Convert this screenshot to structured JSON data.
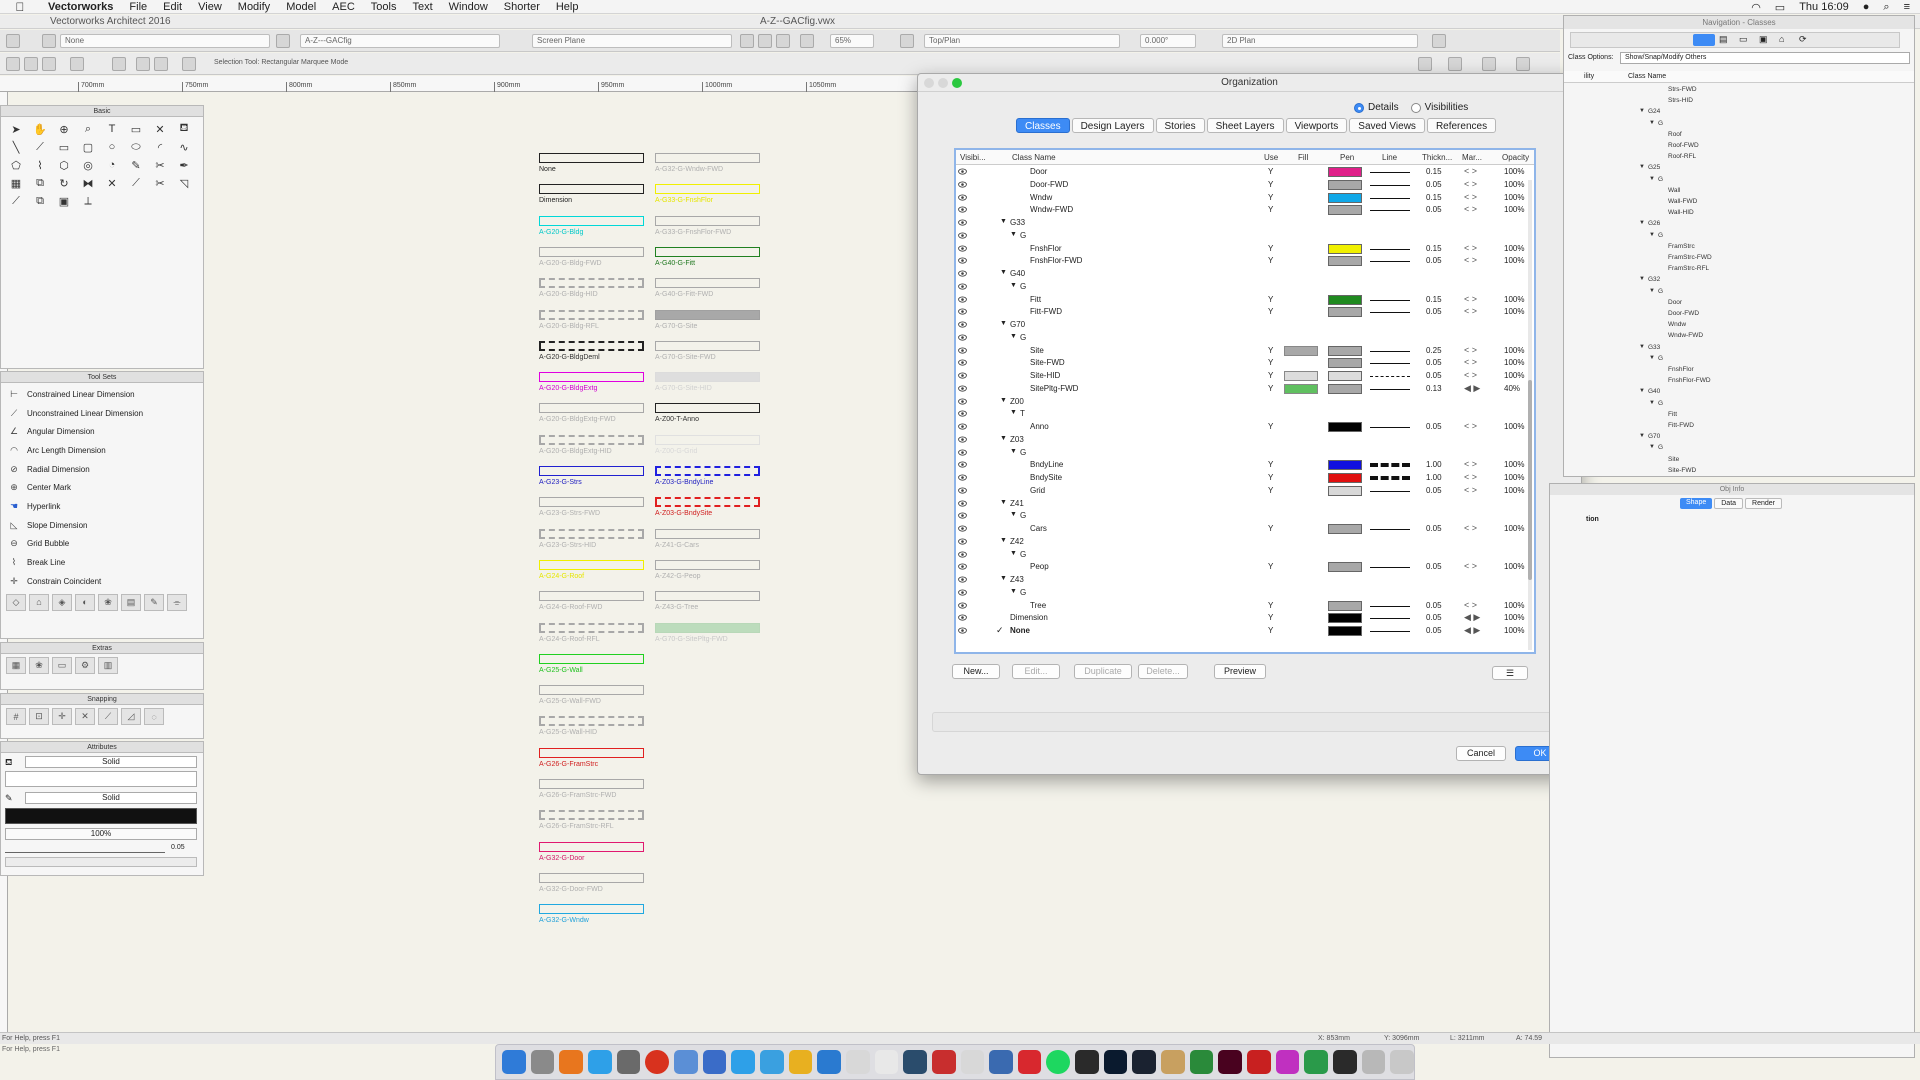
{
  "menubar": {
    "apple": "",
    "app_name": "Vectorworks",
    "items": [
      "File",
      "Edit",
      "View",
      "Modify",
      "Model",
      "AEC",
      "Tools",
      "Text",
      "Window",
      "Shorter",
      "Help"
    ],
    "clock": "Thu 16:09"
  },
  "window": {
    "app_title": "Vectorworks Architect 2016",
    "doc_title": "A-Z--GACfig.vwx"
  },
  "viewbar": {
    "class_field": "None",
    "layer_field": "A-Z---GACfig",
    "plane_field": "Screen Plane",
    "zoom_field": "65%",
    "view_field": "Top/Plan",
    "angle_field": "0.000°",
    "render_field": "2D Plan"
  },
  "modebar": {
    "hint": "Selection Tool: Rectangular Marquee Mode"
  },
  "ruler": {
    "ticks": [
      "700mm",
      "750mm",
      "800mm",
      "850mm",
      "900mm",
      "950mm",
      "1000mm",
      "1050mm"
    ]
  },
  "palettes": {
    "basic_title": "Basic",
    "toolsets_title": "Tool Sets",
    "extras_title": "Extras",
    "snapping_title": "Snapping",
    "attributes_title": "Attributes",
    "toolsets": [
      "Constrained Linear Dimension",
      "Unconstrained Linear Dimension",
      "Angular Dimension",
      "Arc Length Dimension",
      "Radial Dimension",
      "Center Mark",
      "Hyperlink",
      "Slope Dimension",
      "Grid Bubble",
      "Break Line",
      "Constrain Coincident"
    ],
    "attributes": {
      "fill_style": "Solid",
      "pen_style": "Solid",
      "opacity": "100%",
      "thickness": "0.05"
    }
  },
  "canvas": {
    "col1": [
      {
        "label": "None",
        "color": "#222222",
        "dashed": false,
        "labelColor": "#222222"
      },
      {
        "label": "Dimension",
        "color": "#222222",
        "dashed": false,
        "labelColor": "#222222"
      },
      {
        "label": "A-G20-G-Bldg",
        "color": "#00d8d8",
        "dashed": false,
        "labelColor": "#00c8c8"
      },
      {
        "label": "A-G20-G-Bldg-FWD",
        "color": "#a8a8a8",
        "dashed": false,
        "labelColor": "#b0b0b0"
      },
      {
        "label": "A-G20-G-Bldg-HID",
        "color": "#a8a8a8",
        "dashed": true,
        "labelColor": "#b0b0b0"
      },
      {
        "label": "A-G20-G-Bldg-RFL",
        "color": "#a8a8a8",
        "dashed": true,
        "labelColor": "#b0b0b0"
      },
      {
        "label": "A-G20-G-BldgDeml",
        "color": "#222222",
        "dashed": true,
        "labelColor": "#333333"
      },
      {
        "label": "A-G20-G-BldgExtg",
        "color": "#e000e0",
        "dashed": false,
        "labelColor": "#d000d0"
      },
      {
        "label": "A-G20-G-BldgExtg-FWD",
        "color": "#a8a8a8",
        "dashed": false,
        "labelColor": "#b0b0b0"
      },
      {
        "label": "A-G20-G-BldgExtg-HID",
        "color": "#a8a8a8",
        "dashed": true,
        "labelColor": "#b0b0b0"
      },
      {
        "label": "A-G23-G-Strs",
        "color": "#2020d0",
        "dashed": false,
        "labelColor": "#2020c0"
      },
      {
        "label": "A-G23-G-Strs-FWD",
        "color": "#a8a8a8",
        "dashed": false,
        "labelColor": "#b0b0b0"
      },
      {
        "label": "A-G23-G-Strs-HID",
        "color": "#a8a8a8",
        "dashed": true,
        "labelColor": "#b0b0b0"
      },
      {
        "label": "A-G24-G-Roof",
        "color": "#f0f000",
        "dashed": false,
        "labelColor": "#e6e600"
      },
      {
        "label": "A-G24-G-Roof-FWD",
        "color": "#a8a8a8",
        "dashed": false,
        "labelColor": "#b0b0b0"
      },
      {
        "label": "A-G24-G-Roof-RFL",
        "color": "#a8a8a8",
        "dashed": true,
        "labelColor": "#b0b0b0"
      },
      {
        "label": "A-G25-G-Wall",
        "color": "#20d020",
        "dashed": false,
        "labelColor": "#20c020"
      },
      {
        "label": "A-G25-G-Wall-FWD",
        "color": "#a8a8a8",
        "dashed": false,
        "labelColor": "#b0b0b0"
      },
      {
        "label": "A-G25-G-Wall-HID",
        "color": "#a8a8a8",
        "dashed": true,
        "labelColor": "#b0b0b0"
      },
      {
        "label": "A-G26-G-FramStrc",
        "color": "#e02020",
        "dashed": false,
        "labelColor": "#d02020"
      },
      {
        "label": "A-G26-G-FramStrc-FWD",
        "color": "#a8a8a8",
        "dashed": false,
        "labelColor": "#b0b0b0"
      },
      {
        "label": "A-G26-G-FramStrc-RFL",
        "color": "#a8a8a8",
        "dashed": true,
        "labelColor": "#b0b0b0"
      },
      {
        "label": "A-G32-G-Door",
        "color": "#e01870",
        "dashed": false,
        "labelColor": "#d01868"
      },
      {
        "label": "A-G32-G-Door-FWD",
        "color": "#a8a8a8",
        "dashed": false,
        "labelColor": "#b0b0b0"
      },
      {
        "label": "A-G32-G-Wndw",
        "color": "#20a8e0",
        "dashed": false,
        "labelColor": "#20a0d8"
      }
    ],
    "col2": [
      {
        "label": "A-G32-G-Wndw-FWD",
        "color": "#a8a8a8",
        "dashed": false,
        "labelColor": "#b0b0b0"
      },
      {
        "label": "A-G33-G-FnshFlor",
        "color": "#f0f000",
        "dashed": false,
        "labelColor": "#e6e600"
      },
      {
        "label": "A-G33-G-FnshFlor-FWD",
        "color": "#a8a8a8",
        "dashed": false,
        "labelColor": "#b0b0b0"
      },
      {
        "label": "A-G40-G-Fitt",
        "color": "#208020",
        "dashed": false,
        "labelColor": "#207820"
      },
      {
        "label": "A-G40-G-Fitt-FWD",
        "color": "#a8a8a8",
        "dashed": false,
        "labelColor": "#b0b0b0"
      },
      {
        "label": "A-G70-G-Site",
        "color": "#a0a0a0",
        "dashed": false,
        "labelColor": "#b0b0b0",
        "fill": "#a8a8a8"
      },
      {
        "label": "A-G70-G-Site-FWD",
        "color": "#a8a8a8",
        "dashed": false,
        "labelColor": "#b0b0b0"
      },
      {
        "label": "A-G70-G-Site-HID",
        "color": "#dcdcdc",
        "dashed": false,
        "labelColor": "#d0d0d0",
        "fill": "#dedede"
      },
      {
        "label": "A-Z00-T-Anno",
        "color": "#222222",
        "dashed": false,
        "labelColor": "#333333"
      },
      {
        "label": "A-Z00-G-Grid",
        "color": "#e0e0e0",
        "dashed": false,
        "labelColor": "#d8d8d8"
      },
      {
        "label": "A-Z03-G-BndyLine",
        "color": "#2020e0",
        "dashed": true,
        "labelColor": "#2020c0"
      },
      {
        "label": "A-Z03-G-BndySite",
        "color": "#e02020",
        "dashed": true,
        "labelColor": "#d02020"
      },
      {
        "label": "A-Z41-G-Cars",
        "color": "#a8a8a8",
        "dashed": false,
        "labelColor": "#b0b0b0"
      },
      {
        "label": "A-Z42-G-Peop",
        "color": "#a8a8a8",
        "dashed": false,
        "labelColor": "#b0b0b0"
      },
      {
        "label": "A-Z43-G-Tree",
        "color": "#a8a8a8",
        "dashed": false,
        "labelColor": "#b0b0b0"
      },
      {
        "label": "A-G70-G-SitePltg-FWD",
        "color": "#b8d8b8",
        "dashed": false,
        "labelColor": "#c8c8c8",
        "fill": "#bcdcbc"
      }
    ]
  },
  "dialog": {
    "title": "Organization",
    "radio_details": "Details",
    "radio_visibilities": "Visibilities",
    "tabs": [
      "Classes",
      "Design Layers",
      "Stories",
      "Sheet Layers",
      "Viewports",
      "Saved Views",
      "References"
    ],
    "columns": {
      "visibility": "Visibi...",
      "class_name": "Class Name",
      "use": "Use",
      "fill": "Fill",
      "pen": "Pen",
      "line": "Line",
      "thickness": "Thickn...",
      "marker": "Mar...",
      "opacity": "Opacity"
    },
    "rows": [
      {
        "name": "Door",
        "level": 3,
        "use": "Y",
        "pen": "#e0208a",
        "thk": "0.15",
        "mar": "< >",
        "op": "100%"
      },
      {
        "name": "Door-FWD",
        "level": 3,
        "use": "Y",
        "pen": "#a8a8a8",
        "thk": "0.05",
        "mar": "< >",
        "op": "100%"
      },
      {
        "name": "Wndw",
        "level": 3,
        "use": "Y",
        "pen": "#10a8e8",
        "thk": "0.15",
        "mar": "< >",
        "op": "100%"
      },
      {
        "name": "Wndw-FWD",
        "level": 3,
        "use": "Y",
        "pen": "#a8a8a8",
        "thk": "0.05",
        "mar": "< >",
        "op": "100%"
      },
      {
        "name": "G33",
        "level": 1,
        "group": true
      },
      {
        "name": "G",
        "level": 2,
        "group": true
      },
      {
        "name": "FnshFlor",
        "level": 3,
        "use": "Y",
        "pen": "#f0f000",
        "thk": "0.15",
        "mar": "< >",
        "op": "100%"
      },
      {
        "name": "FnshFlor-FWD",
        "level": 3,
        "use": "Y",
        "pen": "#a8a8a8",
        "thk": "0.05",
        "mar": "< >",
        "op": "100%"
      },
      {
        "name": "G40",
        "level": 1,
        "group": true
      },
      {
        "name": "G",
        "level": 2,
        "group": true
      },
      {
        "name": "Fitt",
        "level": 3,
        "use": "Y",
        "pen": "#208a20",
        "thk": "0.15",
        "mar": "< >",
        "op": "100%"
      },
      {
        "name": "Fitt-FWD",
        "level": 3,
        "use": "Y",
        "pen": "#a8a8a8",
        "thk": "0.05",
        "mar": "< >",
        "op": "100%"
      },
      {
        "name": "G70",
        "level": 1,
        "group": true
      },
      {
        "name": "G",
        "level": 2,
        "group": true
      },
      {
        "name": "Site",
        "level": 3,
        "use": "Y",
        "fill": "#a8a8a8",
        "pen": "#a8a8a8",
        "thk": "0.25",
        "mar": "< >",
        "op": "100%"
      },
      {
        "name": "Site-FWD",
        "level": 3,
        "use": "Y",
        "pen": "#a8a8a8",
        "thk": "0.05",
        "mar": "< >",
        "op": "100%"
      },
      {
        "name": "Site-HID",
        "level": 3,
        "use": "Y",
        "fill": "#dcdcdc",
        "pen": "#dcdcdc",
        "thk": "0.05",
        "mar": "< >",
        "op": "100%",
        "dashed": true
      },
      {
        "name": "SitePltg-FWD",
        "level": 3,
        "use": "Y",
        "fill": "#60c060",
        "pen": "#a8a8a8",
        "thk": "0.13",
        "mar": "◀ ▶",
        "op": "40%"
      },
      {
        "name": "Z00",
        "level": 1,
        "group": true
      },
      {
        "name": "T",
        "level": 2,
        "group": true
      },
      {
        "name": "Anno",
        "level": 3,
        "use": "Y",
        "pen": "#000000",
        "thk": "0.05",
        "mar": "< >",
        "op": "100%"
      },
      {
        "name": "Z03",
        "level": 1,
        "group": true
      },
      {
        "name": "G",
        "level": 2,
        "group": true
      },
      {
        "name": "BndyLine",
        "level": 3,
        "use": "Y",
        "pen": "#1010e0",
        "thk": "1.00",
        "mar": "< >",
        "op": "100%",
        "heavy": true
      },
      {
        "name": "BndySite",
        "level": 3,
        "use": "Y",
        "pen": "#e01010",
        "thk": "1.00",
        "mar": "< >",
        "op": "100%",
        "heavy": true
      },
      {
        "name": "Grid",
        "level": 3,
        "use": "Y",
        "pen": "#d8d8d8",
        "thk": "0.05",
        "mar": "< >",
        "op": "100%"
      },
      {
        "name": "Z41",
        "level": 1,
        "group": true
      },
      {
        "name": "G",
        "level": 2,
        "group": true
      },
      {
        "name": "Cars",
        "level": 3,
        "use": "Y",
        "pen": "#a8a8a8",
        "thk": "0.05",
        "mar": "< >",
        "op": "100%"
      },
      {
        "name": "Z42",
        "level": 1,
        "group": true
      },
      {
        "name": "G",
        "level": 2,
        "group": true
      },
      {
        "name": "Peop",
        "level": 3,
        "use": "Y",
        "pen": "#a8a8a8",
        "thk": "0.05",
        "mar": "< >",
        "op": "100%"
      },
      {
        "name": "Z43",
        "level": 1,
        "group": true
      },
      {
        "name": "G",
        "level": 2,
        "group": true
      },
      {
        "name": "Tree",
        "level": 3,
        "use": "Y",
        "pen": "#a8a8a8",
        "thk": "0.05",
        "mar": "< >",
        "op": "100%"
      },
      {
        "name": "Dimension",
        "level": 1,
        "use": "Y",
        "pen": "#000000",
        "thk": "0.05",
        "mar": "◀ ▶",
        "op": "100%"
      },
      {
        "name": "None",
        "level": 1,
        "use": "Y",
        "pen": "#000000",
        "thk": "0.05",
        "mar": "◀ ▶",
        "op": "100%",
        "checked": true,
        "bold": true
      }
    ],
    "buttons": {
      "new": "New...",
      "edit": "Edit...",
      "duplicate": "Duplicate",
      "delete": "Delete...",
      "preview": "Preview",
      "cancel": "Cancel",
      "ok": "OK"
    }
  },
  "nav": {
    "title": "Navigation - Classes",
    "options_label": "Class Options:",
    "options_value": "Show/Snap/Modify Others",
    "col_visibility": "ility",
    "col_name": "Class Name",
    "rows": [
      {
        "t": "Strs-FWD",
        "l": 3
      },
      {
        "t": "Strs-HID",
        "l": 3
      },
      {
        "t": "G24",
        "l": 1
      },
      {
        "t": "G",
        "l": 2
      },
      {
        "t": "Roof",
        "l": 3
      },
      {
        "t": "Roof-FWD",
        "l": 3
      },
      {
        "t": "Roof-RFL",
        "l": 3
      },
      {
        "t": "G25",
        "l": 1
      },
      {
        "t": "G",
        "l": 2
      },
      {
        "t": "Wall",
        "l": 3
      },
      {
        "t": "Wall-FWD",
        "l": 3
      },
      {
        "t": "Wall-HID",
        "l": 3
      },
      {
        "t": "G26",
        "l": 1
      },
      {
        "t": "G",
        "l": 2
      },
      {
        "t": "FramStrc",
        "l": 3
      },
      {
        "t": "FramStrc-FWD",
        "l": 3
      },
      {
        "t": "FramStrc-RFL",
        "l": 3
      },
      {
        "t": "G32",
        "l": 1
      },
      {
        "t": "G",
        "l": 2
      },
      {
        "t": "Door",
        "l": 3
      },
      {
        "t": "Door-FWD",
        "l": 3
      },
      {
        "t": "Wndw",
        "l": 3
      },
      {
        "t": "Wndw-FWD",
        "l": 3
      },
      {
        "t": "G33",
        "l": 1
      },
      {
        "t": "G",
        "l": 2
      },
      {
        "t": "FnshFlor",
        "l": 3
      },
      {
        "t": "FnshFlor-FWD",
        "l": 3
      },
      {
        "t": "G40",
        "l": 1
      },
      {
        "t": "G",
        "l": 2
      },
      {
        "t": "Fitt",
        "l": 3
      },
      {
        "t": "Fitt-FWD",
        "l": 3
      },
      {
        "t": "G70",
        "l": 1
      },
      {
        "t": "G",
        "l": 2
      },
      {
        "t": "Site",
        "l": 3
      },
      {
        "t": "Site-FWD",
        "l": 3
      }
    ]
  },
  "objinfo": {
    "title": "Obj Info",
    "tabs": [
      "Shape",
      "Data",
      "Render"
    ],
    "body": "tion"
  },
  "status": {
    "left": "For Help, press F1",
    "readout_x": "X: 853mm",
    "readout_y": "Y: 3096mm",
    "readout_l": "L: 3211mm",
    "readout_a": "A: 74.59"
  }
}
